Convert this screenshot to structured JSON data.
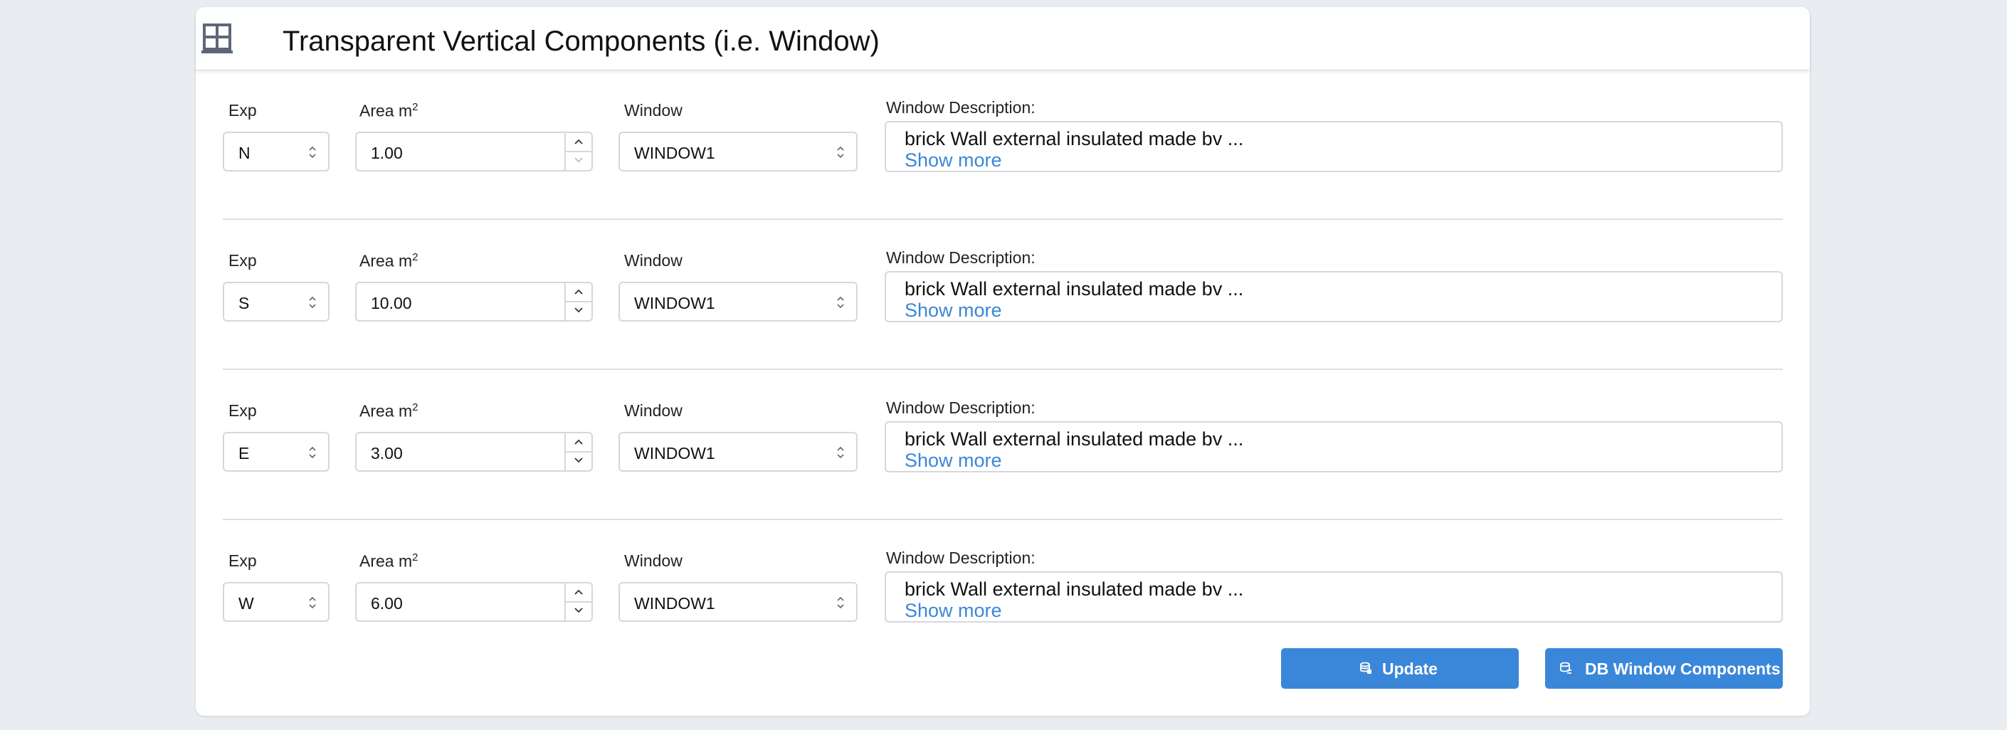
{
  "header": {
    "title": "Transparent Vertical Components (i.e. Window)",
    "icon": "window-grid-icon"
  },
  "labels": {
    "exp": "Exp",
    "area": "Area m",
    "area_sup": "2",
    "window": "Window",
    "description": "Window Description:"
  },
  "rows": [
    {
      "exp": "N",
      "area": "1.00",
      "window": "WINDOW1",
      "description": "brick Wall external insulated made bv ...",
      "show_more": "Show more"
    },
    {
      "exp": "S",
      "area": "10.00",
      "window": "WINDOW1",
      "description": "brick Wall external insulated made bv ...",
      "show_more": "Show more"
    },
    {
      "exp": "E",
      "area": "3.00",
      "window": "WINDOW1",
      "description": "brick Wall external insulated made bv ...",
      "show_more": "Show more"
    },
    {
      "exp": "W",
      "area": "6.00",
      "window": "WINDOW1",
      "description": "brick Wall external insulated made bv ...",
      "show_more": "Show more"
    }
  ],
  "buttons": {
    "update": "Update",
    "db": "DB Window Components"
  },
  "colors": {
    "accent": "#3a87d9",
    "background": "#e9ecf0",
    "border": "#d4d8dc"
  }
}
